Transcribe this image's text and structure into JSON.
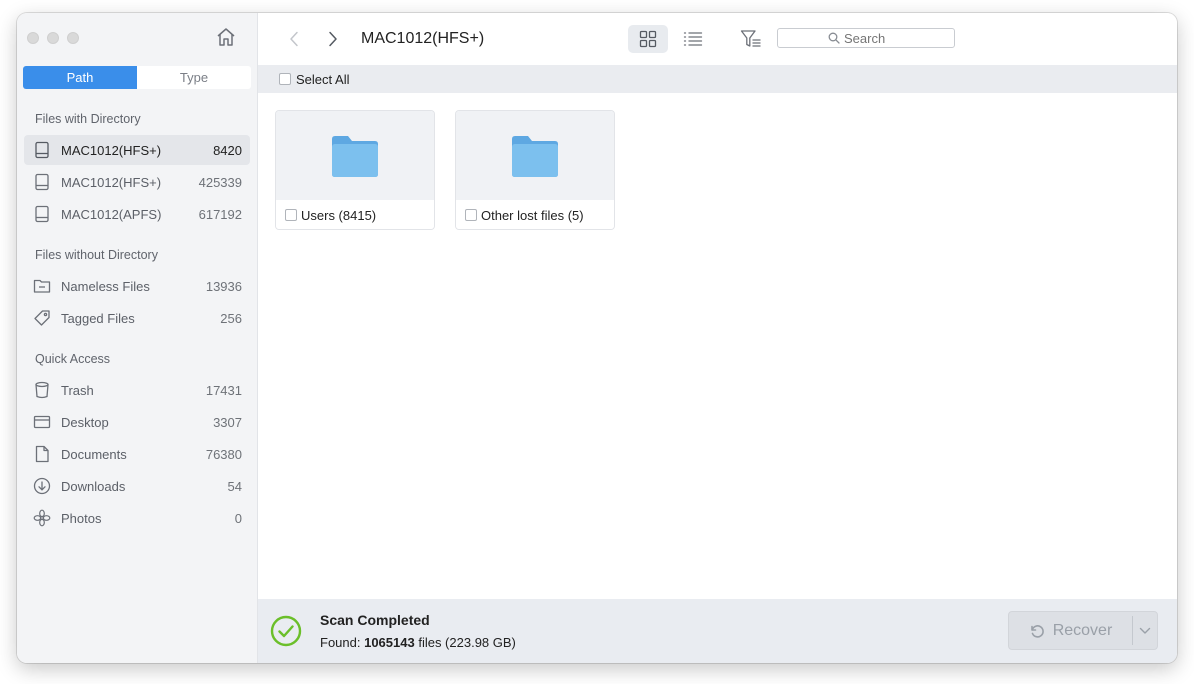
{
  "sidebar": {
    "tabs": {
      "path": "Path",
      "type": "Type"
    },
    "sections": {
      "with_dir": "Files with Directory",
      "without_dir": "Files without Directory",
      "quick_access": "Quick Access"
    },
    "drives": [
      {
        "label": "MAC1012(HFS+)",
        "count": "8420"
      },
      {
        "label": "MAC1012(HFS+)",
        "count": "425339"
      },
      {
        "label": "MAC1012(APFS)",
        "count": "617192"
      }
    ],
    "nodir": [
      {
        "label": "Nameless Files",
        "count": "13936"
      },
      {
        "label": "Tagged Files",
        "count": "256"
      }
    ],
    "quick": [
      {
        "label": "Trash",
        "count": "17431"
      },
      {
        "label": "Desktop",
        "count": "3307"
      },
      {
        "label": "Documents",
        "count": "76380"
      },
      {
        "label": "Downloads",
        "count": "54"
      },
      {
        "label": "Photos",
        "count": "0"
      }
    ]
  },
  "toolbar": {
    "breadcrumb": "MAC1012(HFS+)",
    "search_placeholder": "Search"
  },
  "select_all": "Select All",
  "folders": [
    {
      "label": "Users (8415)"
    },
    {
      "label": "Other lost files (5)"
    }
  ],
  "status": {
    "title": "Scan Completed",
    "found_prefix": "Found: ",
    "found_count": "1065143",
    "found_suffix": " files (223.98 GB)",
    "recover_label": "Recover"
  },
  "colors": {
    "accent": "#3a8eea",
    "success": "#6bbf2a",
    "folder": "#6fb7ea"
  }
}
